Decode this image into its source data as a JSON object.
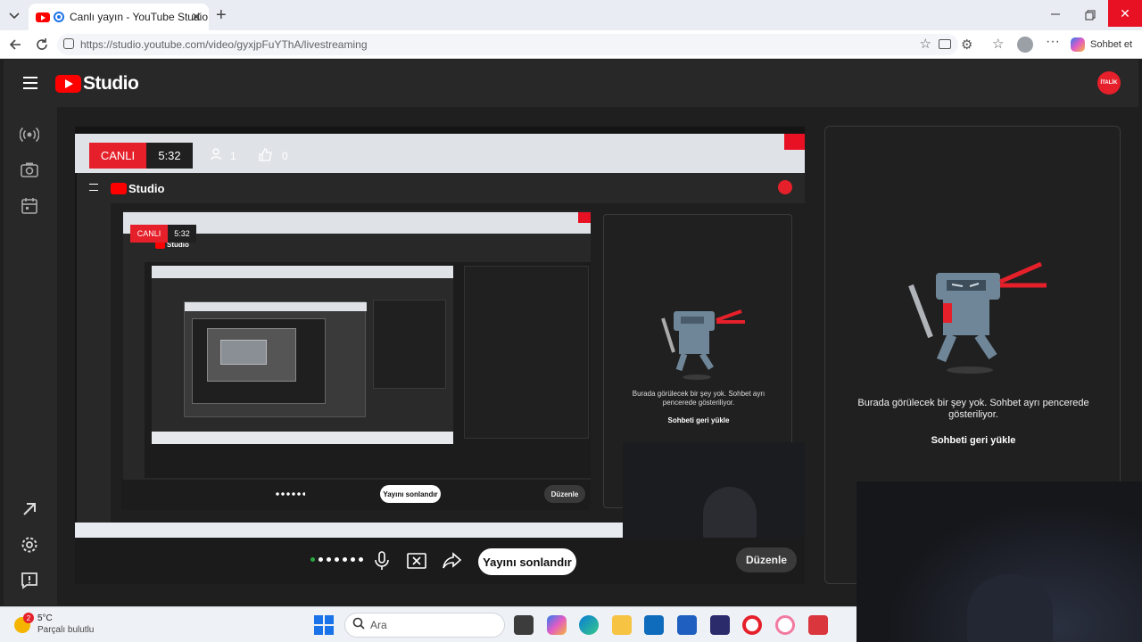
{
  "browser": {
    "tab_title": "Canlı yayın - YouTube Studio",
    "url": "https://studio.youtube.com/video/gyxjpFuYThA/livestreaming",
    "copilot_label": "Sohbet et"
  },
  "studio": {
    "logo_text": "Studio",
    "avatar_text": "İTALİK"
  },
  "stream": {
    "live_label": "CANLI",
    "elapsed": "5:32",
    "viewers": "1",
    "likes": "0",
    "end_button": "Yayını sonlandır",
    "edit_button": "Düzenle"
  },
  "chat": {
    "empty_message": "Burada görülecek bir şey yok. Sohbet ayrı pencerede gösteriliyor.",
    "reload_button": "Sohbeti geri yükle"
  },
  "weather": {
    "temp": "5°C",
    "condition": "Parçalı bulutlu",
    "badge": "2"
  },
  "taskbar": {
    "search_placeholder": "Ara"
  },
  "colors": {
    "accent_red": "#e5202a",
    "youtube_red": "#ff0000",
    "studio_bg": "#282828"
  }
}
